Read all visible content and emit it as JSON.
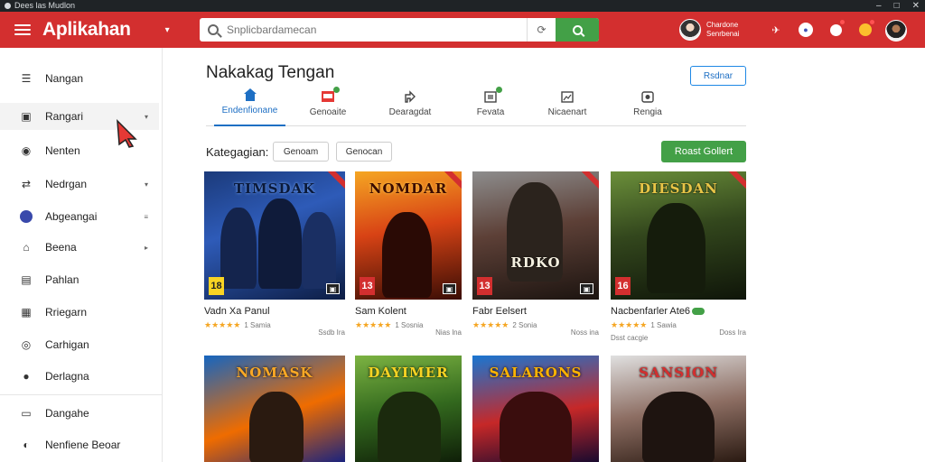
{
  "window": {
    "title": "Dees las Mudlon"
  },
  "header": {
    "brand": "Aplikahan",
    "search_placeholder": "Snplicbardamecan",
    "user": {
      "name_line1": "Chardone",
      "name_line2": "Senrbenai"
    }
  },
  "sidebar": {
    "items": [
      {
        "label": "Nangan",
        "icon": "list-icon",
        "arrow": ""
      },
      {
        "label": "Rangari",
        "icon": "folder-icon",
        "arrow": "▾",
        "active": true
      },
      {
        "label": "Nenten",
        "icon": "circle-icon",
        "arrow": ""
      },
      {
        "label": "Nedrgan",
        "icon": "shuffle-icon",
        "arrow": "▾"
      },
      {
        "label": "Abgeangai",
        "icon": "globe-icon",
        "arrow": "≡"
      },
      {
        "label": "Beena",
        "icon": "tag-icon",
        "arrow": "▸"
      },
      {
        "label": "Pahlan",
        "icon": "document-icon",
        "arrow": ""
      },
      {
        "label": "Rriegarn",
        "icon": "grid-icon",
        "arrow": ""
      },
      {
        "label": "Carhigan",
        "icon": "camera-icon",
        "arrow": ""
      },
      {
        "label": "Derlagna",
        "icon": "pin-icon",
        "arrow": ""
      }
    ],
    "bottom_items": [
      {
        "label": "Dangahe",
        "icon": "chat-icon"
      },
      {
        "label": "Nenfiene Beoar",
        "icon": "shield-icon"
      }
    ]
  },
  "main": {
    "title": "Nakakag Tengan",
    "top_button": "Rsdnar",
    "tabs": [
      {
        "label": "Endenfionane",
        "icon": "home-icon",
        "active": true
      },
      {
        "label": "Genoaite",
        "icon": "inbox-icon",
        "dot": true
      },
      {
        "label": "Dearagdat",
        "icon": "upload-icon"
      },
      {
        "label": "Fevata",
        "icon": "image-icon",
        "dot": true
      },
      {
        "label": "Nicaenart",
        "icon": "gallery-icon"
      },
      {
        "label": "Rengia",
        "icon": "photo-icon"
      }
    ],
    "category_label": "Kategagian:",
    "chips": [
      "Genoam",
      "Genocan"
    ],
    "action_button": "Roast Gollert",
    "games": [
      {
        "art_title": "TIMSDAK",
        "title": "Vadn Xa Panul",
        "rating_badge": "18",
        "stars": "★★★★★",
        "rating_count": "1 Samia",
        "size": "Ssdb Ira",
        "downloads": ""
      },
      {
        "art_title": "NOMDAR",
        "title": "Sam Kolent",
        "rating_badge": "13",
        "stars": "★★★★★",
        "rating_count": "1 Sosnia",
        "size": "Nias lna",
        "downloads": ""
      },
      {
        "art_title": "RDKO",
        "title": "Fabr Eelsert",
        "rating_badge": "13",
        "stars": "★★★★★",
        "rating_count": "2 Sonia",
        "size": "Noss ina",
        "downloads": ""
      },
      {
        "art_title": "DIESDAN",
        "title": "Nacbenfarler Ate6",
        "rating_badge": "16",
        "stars": "★★★★★",
        "rating_count": "1 Sawia",
        "size": "Doss Ira",
        "downloads": "Dsst cacgie"
      },
      {
        "art_title": "NOMASK",
        "title": "",
        "rating_badge": "",
        "stars": "",
        "rating_count": "",
        "size": "",
        "downloads": ""
      },
      {
        "art_title": "DAYIMER",
        "title": "",
        "rating_badge": "",
        "stars": "",
        "rating_count": "",
        "size": "",
        "downloads": ""
      },
      {
        "art_title": "SALARONS",
        "title": "",
        "rating_badge": "",
        "stars": "",
        "rating_count": "",
        "size": "",
        "downloads": ""
      },
      {
        "art_title": "SANSION",
        "title": "",
        "rating_badge": "",
        "stars": "",
        "rating_count": "",
        "size": "",
        "downloads": ""
      }
    ]
  },
  "colors": {
    "header_red": "#d32f2f",
    "accent_green": "#43a047",
    "accent_blue": "#1e6fc4",
    "star_orange": "#f5a623"
  }
}
